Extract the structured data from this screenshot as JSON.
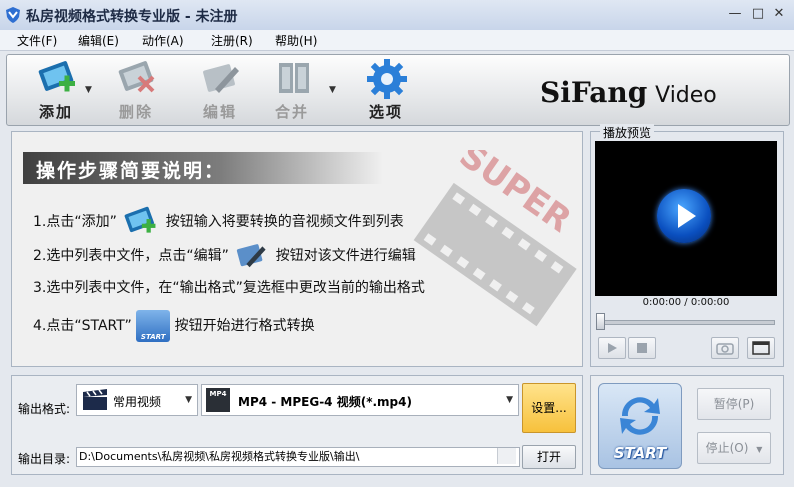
{
  "window": {
    "title": "私房视频格式转换专业版 - 未注册",
    "minimize": "—",
    "maximize": "□",
    "close": "✕"
  },
  "menu": [
    "文件(F)",
    "编辑(E)",
    "动作(A)",
    "注册(R)",
    "帮助(H)"
  ],
  "toolbar": {
    "add": "添加",
    "delete": "删除",
    "edit": "编辑",
    "merge": "合并",
    "options": "选项",
    "dropdown_arrow": "▼"
  },
  "brand": {
    "name": "SiFang",
    "suffix": "Video"
  },
  "instructions": {
    "title": "操作步骤简要说明：",
    "watermark": "SUPER",
    "step1_a": "1.点击“添加”",
    "step1_b": "按钮输入将要转换的音视频文件到列表",
    "step2_a": "2.选中列表中文件，点击“编辑”",
    "step2_b": "按钮对该文件进行编辑",
    "step3": "3.选中列表中文件，在“输出格式”复选框中更改当前的输出格式",
    "step4_a": "4.点击“START”",
    "step4_b": "按钮开始进行格式转换",
    "start_icon_text": "START"
  },
  "preview": {
    "label": "播放预览",
    "time": "0:00:00 / 0:00:00"
  },
  "output": {
    "format_label": "输出格式:",
    "category": "常用视频",
    "format": "MP4 - MPEG-4 视频(*.mp4)",
    "format_icon_text": "MP4",
    "settings": "设置...",
    "dir_label": "输出目录:",
    "dir_value": "D:\\Documents\\私房视频\\私房视频格式转换专业版\\输出\\",
    "open": "打开"
  },
  "controls": {
    "start": "START",
    "pause": "暂停(P)",
    "stop": "停止(O)"
  },
  "colors": {
    "accent": "#1d5fbf",
    "settings_button": "#f7c13c"
  }
}
